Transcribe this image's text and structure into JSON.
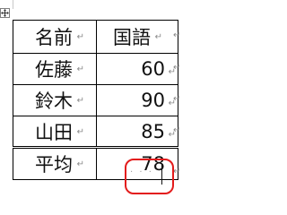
{
  "table": {
    "header": {
      "name": "名前",
      "subject": "国語"
    },
    "rows": [
      {
        "name": "佐藤",
        "score": "60"
      },
      {
        "name": "鈴木",
        "score": "90"
      },
      {
        "name": "山田",
        "score": "85"
      }
    ],
    "footer": {
      "label": "平均",
      "value": "78"
    },
    "cell_end_mark": "↵",
    "row_end_mark": "↵"
  },
  "annotation": {
    "highlight_color": "#e31c1c"
  },
  "icons": {
    "move_handle": "table-move-handle-icon"
  }
}
